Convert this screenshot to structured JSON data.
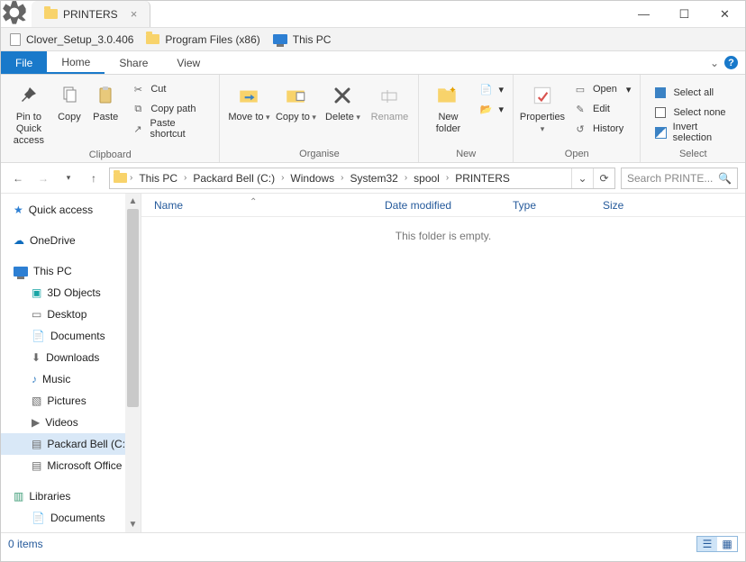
{
  "window": {
    "title": "PRINTERS"
  },
  "shortcuts": {
    "items": [
      "Clover_Setup_3.0.406",
      "Program Files (x86)",
      "This PC"
    ]
  },
  "tabs": {
    "file": "File",
    "items": [
      "Home",
      "Share",
      "View"
    ],
    "active_index": 0
  },
  "ribbon": {
    "clipboard": {
      "label": "Clipboard",
      "pin": "Pin to Quick access",
      "copy": "Copy",
      "paste": "Paste",
      "cut": "Cut",
      "copy_path": "Copy path",
      "paste_shortcut": "Paste shortcut"
    },
    "organise": {
      "label": "Organise",
      "move": "Move to",
      "copy": "Copy to",
      "delete": "Delete",
      "rename": "Rename"
    },
    "new": {
      "label": "New",
      "new_folder": "New folder"
    },
    "open": {
      "label": "Open",
      "properties": "Properties",
      "open": "Open",
      "edit": "Edit",
      "history": "History"
    },
    "select": {
      "label": "Select",
      "all": "Select all",
      "none": "Select none",
      "invert": "Invert selection"
    }
  },
  "breadcrumb": {
    "segments": [
      "This PC",
      "Packard Bell (C:)",
      "Windows",
      "System32",
      "spool",
      "PRINTERS"
    ]
  },
  "search": {
    "placeholder": "Search PRINTE..."
  },
  "tree": {
    "quick_access": "Quick access",
    "onedrive": "OneDrive",
    "this_pc": "This PC",
    "this_pc_children": [
      "3D Objects",
      "Desktop",
      "Documents",
      "Downloads",
      "Music",
      "Pictures",
      "Videos",
      "Packard Bell (C:)",
      "Microsoft Office"
    ],
    "libraries": "Libraries",
    "libraries_children": [
      "Documents"
    ]
  },
  "columns": {
    "name": "Name",
    "date": "Date modified",
    "type": "Type",
    "size": "Size"
  },
  "empty_text": "This folder is empty.",
  "status": {
    "items": "0 items"
  }
}
